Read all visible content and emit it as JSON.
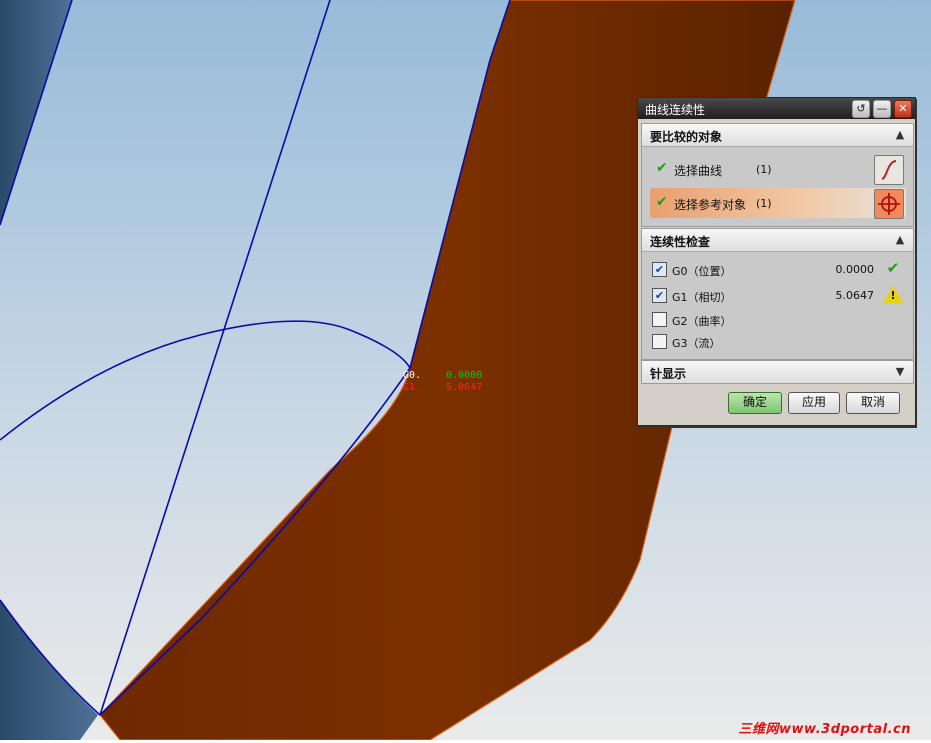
{
  "viewport": {
    "measure_labels": [
      "G0.",
      "G1."
    ],
    "measure_values": [
      "0.0000",
      "5.0647"
    ],
    "colors": {
      "bg_top": "#99bcd8",
      "bg_bottom": "#ecedee",
      "surface": "#7a2e00",
      "curve": "#0a0aa8",
      "g0": "#00cc00",
      "g1": "#ff2020"
    },
    "watermark": "三维网www.3dportal.cn"
  },
  "dialog": {
    "title": "曲线连续性",
    "title_buttons": [
      "reset-icon",
      "minimize-icon",
      "close-icon"
    ],
    "objects_section": {
      "label": "要比较的对象",
      "rows": [
        {
          "label": "选择曲线",
          "count": "(1)",
          "icon": "curve-icon",
          "active": false
        },
        {
          "label": "选择参考对象",
          "count": "(1)",
          "icon": "crosshair-icon",
          "active": true
        }
      ]
    },
    "continuity_section": {
      "label": "连续性检查",
      "rows": [
        {
          "label": "G0（位置）",
          "checked": true,
          "value": "0.0000",
          "status": "ok"
        },
        {
          "label": "G1（相切）",
          "checked": true,
          "value": "5.0647",
          "status": "warning"
        },
        {
          "label": "G2（曲率）",
          "checked": false,
          "value": "",
          "status": ""
        },
        {
          "label": "G3（流）",
          "checked": false,
          "value": "",
          "status": ""
        }
      ]
    },
    "needle_section": {
      "label": "针显示"
    },
    "buttons": {
      "ok": "确定",
      "apply": "应用",
      "cancel": "取消"
    }
  }
}
